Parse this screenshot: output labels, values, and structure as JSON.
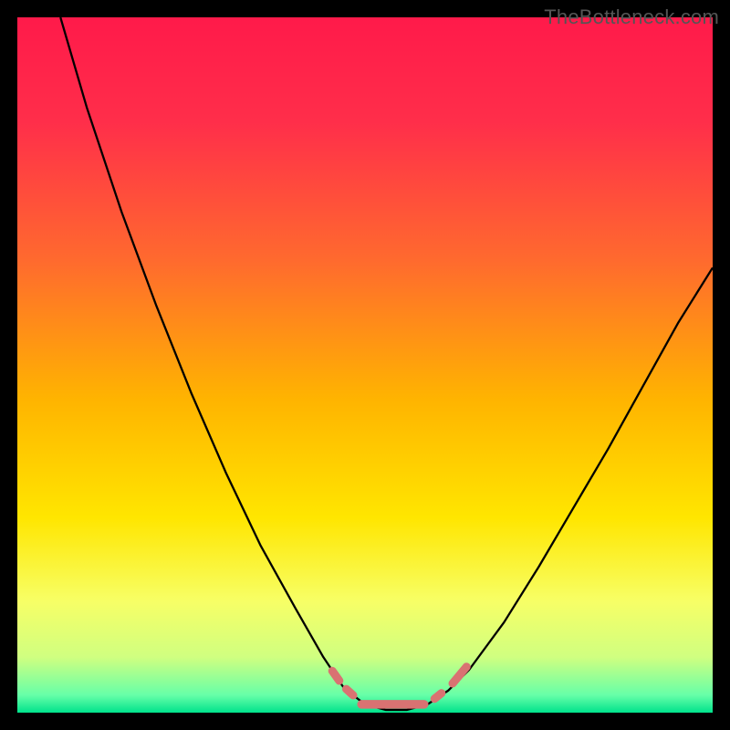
{
  "watermark": "TheBottleneck.com",
  "chart_data": {
    "type": "line",
    "title": "",
    "xlabel": "",
    "ylabel": "",
    "xlim": [
      0,
      100
    ],
    "ylim": [
      0,
      100
    ],
    "grid": false,
    "legend": false,
    "gradient_bg": {
      "stops": [
        {
          "offset": 0.0,
          "color": "#ff1a4a"
        },
        {
          "offset": 0.15,
          "color": "#ff2e4a"
        },
        {
          "offset": 0.35,
          "color": "#ff6a2e"
        },
        {
          "offset": 0.55,
          "color": "#ffb400"
        },
        {
          "offset": 0.72,
          "color": "#ffe600"
        },
        {
          "offset": 0.84,
          "color": "#f7ff66"
        },
        {
          "offset": 0.92,
          "color": "#d0ff80"
        },
        {
          "offset": 0.975,
          "color": "#66ffa8"
        },
        {
          "offset": 1.0,
          "color": "#00e28c"
        }
      ]
    },
    "series": [
      {
        "name": "curve",
        "stroke": "#000000",
        "stroke_width": 2.3,
        "points": [
          {
            "x": 6.2,
            "y": 100.0
          },
          {
            "x": 10.0,
            "y": 87.0
          },
          {
            "x": 15.0,
            "y": 72.0
          },
          {
            "x": 20.0,
            "y": 58.5
          },
          {
            "x": 25.0,
            "y": 46.0
          },
          {
            "x": 30.0,
            "y": 34.5
          },
          {
            "x": 35.0,
            "y": 24.0
          },
          {
            "x": 40.0,
            "y": 15.0
          },
          {
            "x": 44.0,
            "y": 8.0
          },
          {
            "x": 47.0,
            "y": 3.5
          },
          {
            "x": 50.0,
            "y": 1.2
          },
          {
            "x": 53.0,
            "y": 0.4
          },
          {
            "x": 56.0,
            "y": 0.4
          },
          {
            "x": 59.0,
            "y": 1.2
          },
          {
            "x": 62.0,
            "y": 3.2
          },
          {
            "x": 65.0,
            "y": 6.2
          },
          {
            "x": 70.0,
            "y": 13.0
          },
          {
            "x": 75.0,
            "y": 21.0
          },
          {
            "x": 80.0,
            "y": 29.5
          },
          {
            "x": 85.0,
            "y": 38.0
          },
          {
            "x": 90.0,
            "y": 47.0
          },
          {
            "x": 95.0,
            "y": 56.0
          },
          {
            "x": 100.0,
            "y": 64.0
          }
        ]
      },
      {
        "name": "highlight-a",
        "type": "segment",
        "stroke": "#d97272",
        "stroke_width": 9,
        "cap": "round",
        "points": [
          {
            "x": 45.3,
            "y": 6.0
          },
          {
            "x": 46.3,
            "y": 4.6
          }
        ]
      },
      {
        "name": "highlight-b",
        "type": "segment",
        "stroke": "#d97272",
        "stroke_width": 9,
        "cap": "round",
        "points": [
          {
            "x": 47.3,
            "y": 3.4
          },
          {
            "x": 48.3,
            "y": 2.5
          }
        ]
      },
      {
        "name": "highlight-bottom",
        "type": "segment",
        "stroke": "#d97272",
        "stroke_width": 9.5,
        "cap": "round",
        "points": [
          {
            "x": 49.5,
            "y": 1.2
          },
          {
            "x": 58.5,
            "y": 1.2
          }
        ]
      },
      {
        "name": "highlight-c",
        "type": "segment",
        "stroke": "#d97272",
        "stroke_width": 9,
        "cap": "round",
        "points": [
          {
            "x": 60.0,
            "y": 2.0
          },
          {
            "x": 61.0,
            "y": 2.8
          }
        ]
      },
      {
        "name": "highlight-d",
        "type": "segment",
        "stroke": "#d97272",
        "stroke_width": 9,
        "cap": "round",
        "points": [
          {
            "x": 62.6,
            "y": 4.2
          },
          {
            "x": 64.6,
            "y": 6.6
          }
        ]
      }
    ]
  }
}
